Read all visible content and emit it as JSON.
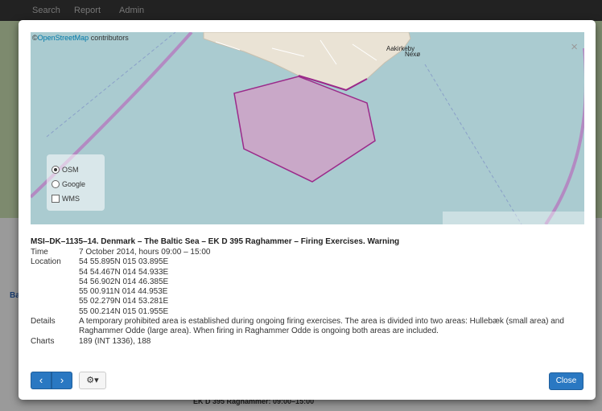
{
  "navbar": {
    "items": [
      "Search",
      "Report",
      "Admin"
    ]
  },
  "background": {
    "bottom_text_1": "EK D 395 Raghammer: 09:00–15:00",
    "side_label": "Ba"
  },
  "map": {
    "attribution_prefix": "©",
    "attribution_link": "OpenStreetMap",
    "attribution_suffix": " contributors",
    "close_glyph": "×",
    "place_aakirkeby": "Aakirkeby",
    "place_nexo": "Nexø",
    "layers": {
      "osm": "OSM",
      "google": "Google",
      "wms": "WMS"
    },
    "selected_layer": "OSM",
    "area_fill_color": "#c9a8c8",
    "area_stroke_color": "#9b2a8a"
  },
  "message": {
    "title": "MSI–DK–1135–14. Denmark – The Baltic Sea – EK D 395 Raghammer – Firing Exercises. Warning",
    "time_label": "Time",
    "time_value": "7 October 2014, hours 09:00 – 15:00",
    "location_label": "Location",
    "locations": [
      "54 55.895N 015 03.895E",
      "54 54.467N 014 54.933E",
      "54 56.902N 014 46.385E",
      "55 00.911N 014 44.953E",
      "55 02.279N 014 53.281E",
      "55 00.214N 015 01.955E"
    ],
    "details_label": "Details",
    "details_value": "A temporary prohibited area is established during ongoing firing exercises. The area is divided into two areas: Hullebæk (small area) and Raghammer Odde (large area). When firing in Raghammer Odde is ongoing both areas are included.",
    "charts_label": "Charts",
    "charts_value": "189 (INT 1336), 188"
  },
  "footer": {
    "prev_glyph": "‹",
    "next_glyph": "›",
    "gear_glyph": "⚙▾",
    "close_label": "Close"
  }
}
